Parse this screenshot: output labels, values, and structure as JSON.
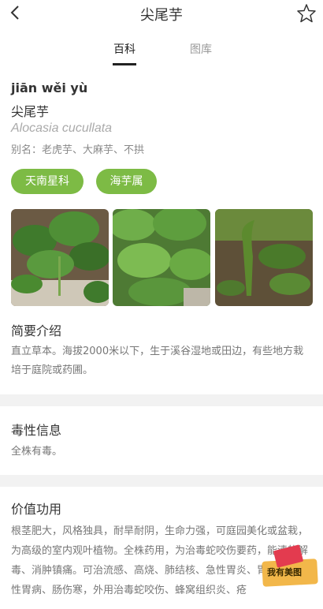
{
  "header": {
    "title": "尖尾芋",
    "tabs": [
      "百科",
      "图库"
    ]
  },
  "plant": {
    "pinyin": "jiān wěi yù",
    "name": "尖尾芋",
    "latin": "Alocasia cucullata",
    "alias": "别名：老虎芋、大麻芋、不拱",
    "tags": [
      "天南星科",
      "海芋属"
    ]
  },
  "sections": {
    "intro": {
      "title": "简要介绍",
      "body": "直立草本。海拔2000米以下，生于溪谷湿地或田边，有些地方栽培于庭院或药圃。"
    },
    "toxicity": {
      "title": "毒性信息",
      "body": "全株有毒。"
    },
    "value": {
      "title": "价值功用",
      "body": "根茎肥大，风格独具，耐旱耐阴，生命力强，可庭园美化或盆栽，为高级的室内观叶植物。全株药用，为治毒蛇咬伤要药，能清热解毒、消肿镇痛。可治流感、高烧、肺结核、急性胃炎、胃溃疡、慢性胃病、肠伤寒，外用治毒蛇咬伤、蜂窝组织炎、疮"
    }
  },
  "badge": {
    "label": "我有美图"
  },
  "colors": {
    "tag_bg": "#7dbb45",
    "tab_active": "#222222",
    "tab_inactive": "#999999"
  }
}
